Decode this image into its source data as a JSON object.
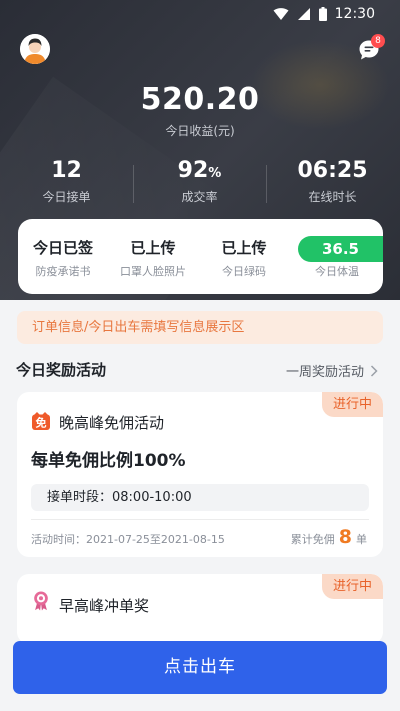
{
  "status_bar": {
    "time": "12:30"
  },
  "header": {
    "message_badge": "8"
  },
  "earnings": {
    "value": "520.20",
    "label": "今日收益(元)"
  },
  "stats": [
    {
      "value": "12",
      "unit": "",
      "label": "今日接单"
    },
    {
      "value": "92",
      "unit": "%",
      "label": "成交率"
    },
    {
      "value": "06:25",
      "unit": "",
      "label": "在线时长"
    }
  ],
  "checks": [
    {
      "value": "今日已签",
      "label": "防疫承诺书"
    },
    {
      "value": "已上传",
      "label": "口罩人脸照片"
    },
    {
      "value": "已上传",
      "label": "今日绿码"
    },
    {
      "value": "36.5",
      "label": "今日体温"
    }
  ],
  "notice": "订单信息/今日出车需填写信息展示区",
  "rewards": {
    "title": "今日奖励活动",
    "link": "一周奖励活动",
    "cards": [
      {
        "badge": "进行中",
        "icon_label": "免",
        "name": "晚高峰免佣活动",
        "headline": "每单免佣比例100%",
        "period": "接单时段：08:00-10:00",
        "date": "活动时间：2021-07-25至2021-08-15",
        "count_prefix": "累计免佣",
        "count": "8",
        "count_unit": "单"
      },
      {
        "badge": "进行中",
        "name": "早高峰冲单奖"
      }
    ]
  },
  "go_button": "点击出车",
  "colors": {
    "primary": "#2f62ea",
    "accent": "#e8622a",
    "temperature": "#21c267"
  }
}
